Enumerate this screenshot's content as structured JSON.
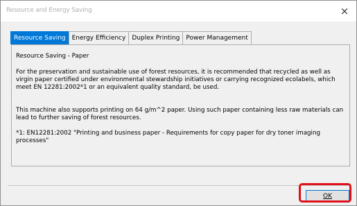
{
  "window": {
    "title": "Resource and Energy Saving",
    "close_glyph": "×"
  },
  "tabs": [
    {
      "label": "Resource Saving",
      "active": true
    },
    {
      "label": "Energy Efficiency",
      "active": false
    },
    {
      "label": "Duplex Printing",
      "active": false
    },
    {
      "label": "Power Management",
      "active": false
    }
  ],
  "content": {
    "heading": "Resource Saving - Paper",
    "para1": "For the preservation and sustainable use of forest resources, it is recommended that recycled as well as virgin paper certified under environmental stewardship initiatives or carrying  recognized ecolabels, which meet EN 12281:2002*1 or an equivalent quality standard, be used.",
    "para2": "This machine also supports printing on 64 g/m^2 paper.  Using such paper containing less raw materials can lead to further saving of forest resources.",
    "footnote": "*1: EN12281:2002 \"Printing and business paper - Requirements for copy paper for dry toner imaging processes\""
  },
  "footer": {
    "ok_label": "OK"
  },
  "colors": {
    "accent": "#0078d7",
    "highlight": "#e0101a"
  }
}
